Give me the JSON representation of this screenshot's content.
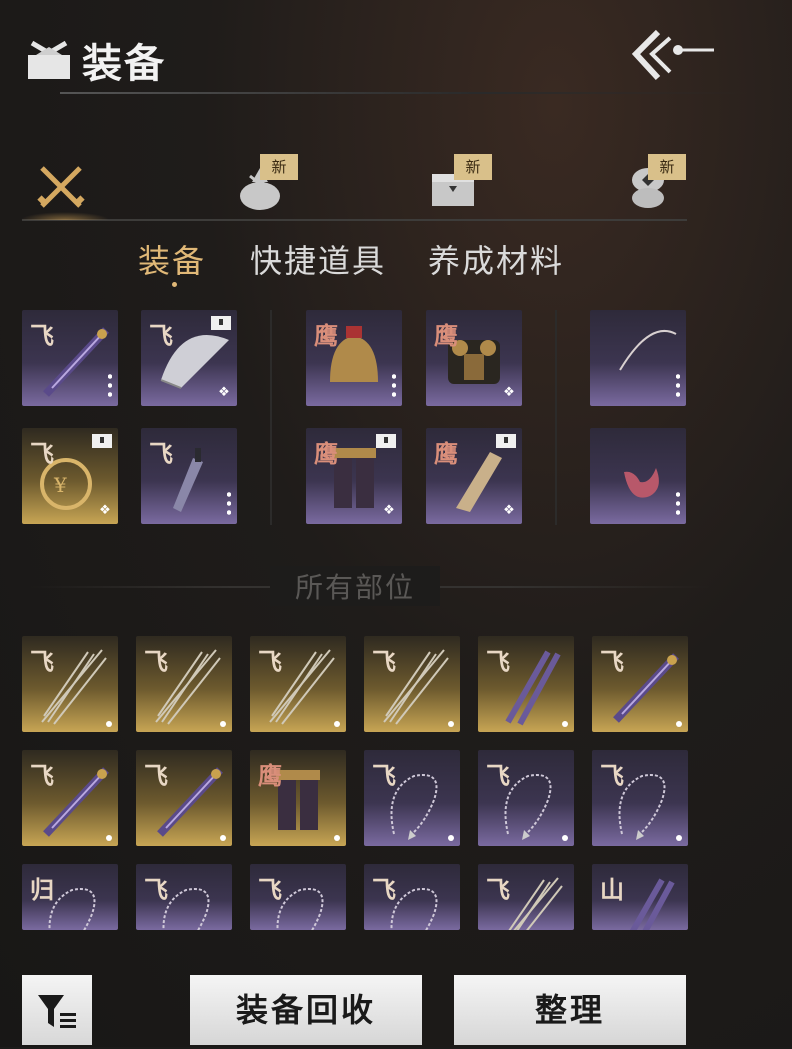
{
  "header": {
    "title": "装备",
    "title_icon": "bundle-icon",
    "back_icon": "back-arrow-icon"
  },
  "categories": [
    {
      "icon": "crossed-swords-icon",
      "active": true,
      "badge": ""
    },
    {
      "icon": "bundle-icon",
      "active": false,
      "badge": "新"
    },
    {
      "icon": "chest-icon",
      "active": false,
      "badge": "新"
    },
    {
      "icon": "coin-stack-icon",
      "active": false,
      "badge": "新"
    }
  ],
  "subtabs": [
    "装备",
    "快捷道具",
    "养成材料"
  ],
  "equipped": {
    "slots": [
      {
        "tier": "飞",
        "rarity": "purple",
        "item": "sword",
        "marker": "dots",
        "tag": false
      },
      {
        "tier": "飞",
        "rarity": "purple",
        "item": "fan",
        "marker": "gem",
        "tag": true
      },
      {
        "tier": "鹰",
        "rarity": "purple",
        "item": "helmet",
        "marker": "dots",
        "tag": false
      },
      {
        "tier": "鹰",
        "rarity": "purple",
        "item": "armor",
        "marker": "gem",
        "tag": false
      },
      {
        "tier": "",
        "rarity": "purple",
        "item": "bow",
        "marker": "dots",
        "tag": false
      },
      {
        "tier": "飞",
        "rarity": "gold",
        "item": "medallion",
        "marker": "gem",
        "tag": true
      },
      {
        "tier": "飞",
        "rarity": "purple",
        "item": "dagger",
        "marker": "dots",
        "tag": false
      },
      {
        "tier": "鹰",
        "rarity": "purple",
        "item": "leggings",
        "marker": "gem",
        "tag": true
      },
      {
        "tier": "鹰",
        "rarity": "purple",
        "item": "bracer",
        "marker": "gem",
        "tag": true
      },
      {
        "tier": "",
        "rarity": "purple",
        "item": "pendant",
        "marker": "dots",
        "tag": false
      }
    ]
  },
  "section_label": "所有部位",
  "inventory": [
    {
      "tier": "飞",
      "rarity": "gold",
      "item": "umbrella"
    },
    {
      "tier": "飞",
      "rarity": "gold",
      "item": "umbrella"
    },
    {
      "tier": "飞",
      "rarity": "gold",
      "item": "umbrella"
    },
    {
      "tier": "飞",
      "rarity": "gold",
      "item": "umbrella"
    },
    {
      "tier": "飞",
      "rarity": "gold",
      "item": "twin-blades"
    },
    {
      "tier": "飞",
      "rarity": "gold",
      "item": "sword"
    },
    {
      "tier": "飞",
      "rarity": "gold",
      "item": "sword"
    },
    {
      "tier": "飞",
      "rarity": "gold",
      "item": "sword"
    },
    {
      "tier": "鹰",
      "rarity": "gold",
      "item": "leggings"
    },
    {
      "tier": "飞",
      "rarity": "purple",
      "item": "rope-dart"
    },
    {
      "tier": "飞",
      "rarity": "purple",
      "item": "rope-dart"
    },
    {
      "tier": "飞",
      "rarity": "purple",
      "item": "rope-dart"
    },
    {
      "tier": "归",
      "rarity": "purple",
      "item": "rope-dart"
    },
    {
      "tier": "飞",
      "rarity": "purple",
      "item": "rope-dart"
    },
    {
      "tier": "飞",
      "rarity": "purple",
      "item": "rope-dart"
    },
    {
      "tier": "飞",
      "rarity": "purple",
      "item": "rope-dart"
    },
    {
      "tier": "飞",
      "rarity": "purple",
      "item": "umbrella"
    },
    {
      "tier": "山",
      "rarity": "purple",
      "item": "twin-blades"
    }
  ],
  "footer": {
    "filter_icon": "filter-icon",
    "recycle_label": "装备回收",
    "sort_label": "整理"
  }
}
